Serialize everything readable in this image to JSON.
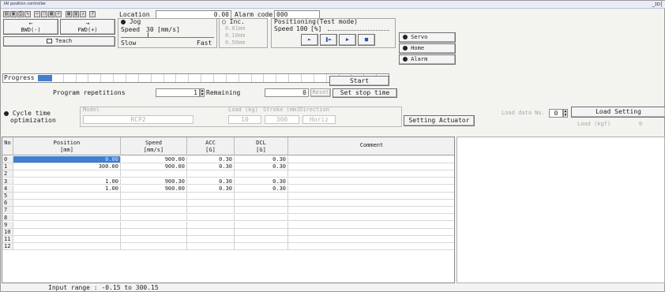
{
  "window": {
    "title": "IAI position controller",
    "close_label": "_ɪɒ|"
  },
  "toolbar": {
    "icons": [
      "open-icon",
      "save-icon",
      "print-icon",
      "edit-icon",
      "cut-icon",
      "copy-icon",
      "paste-icon",
      "find-icon",
      "grid-icon",
      "table-icon",
      "export-icon",
      "help-icon"
    ]
  },
  "location": {
    "label": "Location",
    "value": "0.00",
    "alarm_label": "Alarm code",
    "alarm_value": "000"
  },
  "jog": {
    "bwd_arrow": "←",
    "bwd_label": "BWD(-)",
    "fwd_arrow": "→",
    "fwd_label": "FWD(+)",
    "teach_label": "Teach",
    "mode_label": "Jog",
    "speed_label": "Speed",
    "speed_value": "30",
    "speed_unit": "[mm/s]",
    "slow_label": "Slow",
    "fast_label": "Fast",
    "inc_label": "Inc.",
    "inc_options": [
      "0.01mm",
      "0.10mm",
      "0.50mm"
    ]
  },
  "positioning": {
    "title": "Positioning(Test mode)",
    "speed_label": "Speed",
    "speed_value": "100",
    "speed_unit": "[%]"
  },
  "status_buttons": {
    "servo": "Servo",
    "home": "Home",
    "alarm": "Alarm"
  },
  "progress": {
    "label": "Progress",
    "value_fraction": 0.04
  },
  "program": {
    "repetitions_label": "Program repetitions",
    "repetitions_value": "1",
    "remaining_label": "Remaining",
    "remaining_value": "0",
    "reset_label": "Reset",
    "start_label": "Start",
    "set_stop_time_label": "Set stop time"
  },
  "cycle_opt": {
    "label_line1": "Cycle time",
    "label_line2": "optimization",
    "model_label": "Model",
    "model_value": "RCP2",
    "load_label": "Load (kg)",
    "load_value": "10",
    "stroke_label": "Stroke (mm)",
    "stroke_value": "300",
    "direction_label": "Direction",
    "direction_value": "Horiz",
    "setting_actuator_label": "Setting Actuator",
    "load_data_label": "Load data No.",
    "load_data_value": "0",
    "load_setting_label": "Load Setting",
    "load_kgf_label": "Load (kgf)",
    "load_kgf_value": "0"
  },
  "table": {
    "headers": {
      "no": "No",
      "position": [
        "Position",
        "[mm]"
      ],
      "speed": [
        "Speed",
        "[mm/s]"
      ],
      "acc": [
        "ACC",
        "[G]"
      ],
      "dcl": [
        "DCL",
        "[G]"
      ],
      "comment": "Comment"
    },
    "rows": [
      {
        "no": "0",
        "position": "0.00",
        "speed": "900.00",
        "acc": "0.30",
        "dcl": "0.30",
        "comment": ""
      },
      {
        "no": "1",
        "position": "300.00",
        "speed": "900.00",
        "acc": "0.30",
        "dcl": "0.30",
        "comment": ""
      },
      {
        "no": "2",
        "position": "",
        "speed": "",
        "acc": "",
        "dcl": "",
        "comment": ""
      },
      {
        "no": "3",
        "position": "1.00",
        "speed": "900.30",
        "acc": "0.30",
        "dcl": "0.30",
        "comment": ""
      },
      {
        "no": "4",
        "position": "1.00",
        "speed": "900.00",
        "acc": "0.30",
        "dcl": "0.30",
        "comment": ""
      },
      {
        "no": "5",
        "position": "",
        "speed": "",
        "acc": "",
        "dcl": "",
        "comment": ""
      },
      {
        "no": "6",
        "position": "",
        "speed": "",
        "acc": "",
        "dcl": "",
        "comment": ""
      },
      {
        "no": "7",
        "position": "",
        "speed": "",
        "acc": "",
        "dcl": "",
        "comment": ""
      },
      {
        "no": "8",
        "position": "",
        "speed": "",
        "acc": "",
        "dcl": "",
        "comment": ""
      },
      {
        "no": "9",
        "position": "",
        "speed": "",
        "acc": "",
        "dcl": "",
        "comment": ""
      },
      {
        "no": "10",
        "position": "",
        "speed": "",
        "acc": "",
        "dcl": "",
        "comment": ""
      },
      {
        "no": "11",
        "position": "",
        "speed": "",
        "acc": "",
        "dcl": "",
        "comment": ""
      },
      {
        "no": "12",
        "position": "",
        "speed": "",
        "acc": "",
        "dcl": "",
        "comment": ""
      }
    ]
  },
  "status_bar": {
    "text": "Input range : -0.15 to 300.15"
  },
  "colors": {
    "selection": "#3f7fd0",
    "progress_fill": "#3f7fd0",
    "window_bg": "#f3f3f0"
  }
}
